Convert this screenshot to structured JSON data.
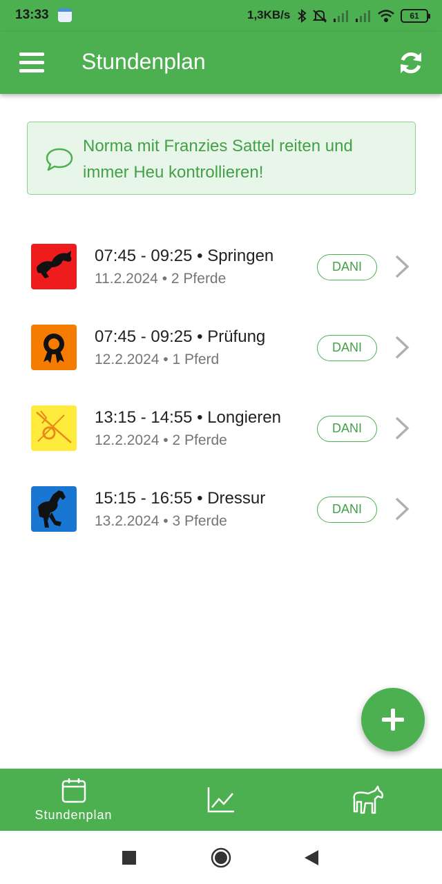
{
  "status_bar": {
    "time": "13:33",
    "network_speed": "1,3KB/s",
    "battery": "61",
    "icons": [
      "calendar-icon",
      "bluetooth-icon",
      "mute-icon",
      "signal-icon",
      "signal-icon",
      "wifi-icon",
      "battery-icon"
    ]
  },
  "app_bar": {
    "title": "Stundenplan",
    "menu_icon": "menu-icon",
    "refresh_icon": "refresh-icon"
  },
  "notice": {
    "icon": "chat-bubble-icon",
    "text": "Norma mit Franzies Sattel reiten und immer Heu kontrollieren!"
  },
  "lessons": [
    {
      "time_range": "07:45 - 09:25",
      "discipline": "Springen",
      "date": "11.2.2024",
      "horses": "2 Pferde",
      "trainer": "DANI",
      "icon": "jumping-horse-icon",
      "icon_bg": "#ee1c1c"
    },
    {
      "time_range": "07:45 - 09:25",
      "discipline": "Prüfung",
      "date": "12.2.2024",
      "horses": "1 Pferd",
      "trainer": "DANI",
      "icon": "rosette-icon",
      "icon_bg": "#f57c00"
    },
    {
      "time_range": "13:15 - 14:55",
      "discipline": "Longieren",
      "date": "12.2.2024",
      "horses": "2 Pferde",
      "trainer": "DANI",
      "icon": "lunge-line-icon",
      "icon_bg": "#ffeb3b"
    },
    {
      "time_range": "15:15 - 16:55",
      "discipline": "Dressur",
      "date": "13.2.2024",
      "horses": "3 Pferde",
      "trainer": "DANI",
      "icon": "dressage-horse-icon",
      "icon_bg": "#1976d2"
    }
  ],
  "separator": " • ",
  "fab": {
    "icon": "plus-icon"
  },
  "bottom_nav": {
    "items": [
      {
        "label": "Stundenplan",
        "icon": "calendar-icon",
        "active": true
      },
      {
        "label": "",
        "icon": "chart-icon",
        "active": false
      },
      {
        "label": "",
        "icon": "horse-icon",
        "active": false
      }
    ]
  },
  "system_nav": {
    "icons": [
      "recents-square-icon",
      "home-circle-icon",
      "back-triangle-icon"
    ]
  },
  "colors": {
    "primary": "#4caf50",
    "notice_bg": "#e8f5e9",
    "notice_text": "#43a047"
  }
}
